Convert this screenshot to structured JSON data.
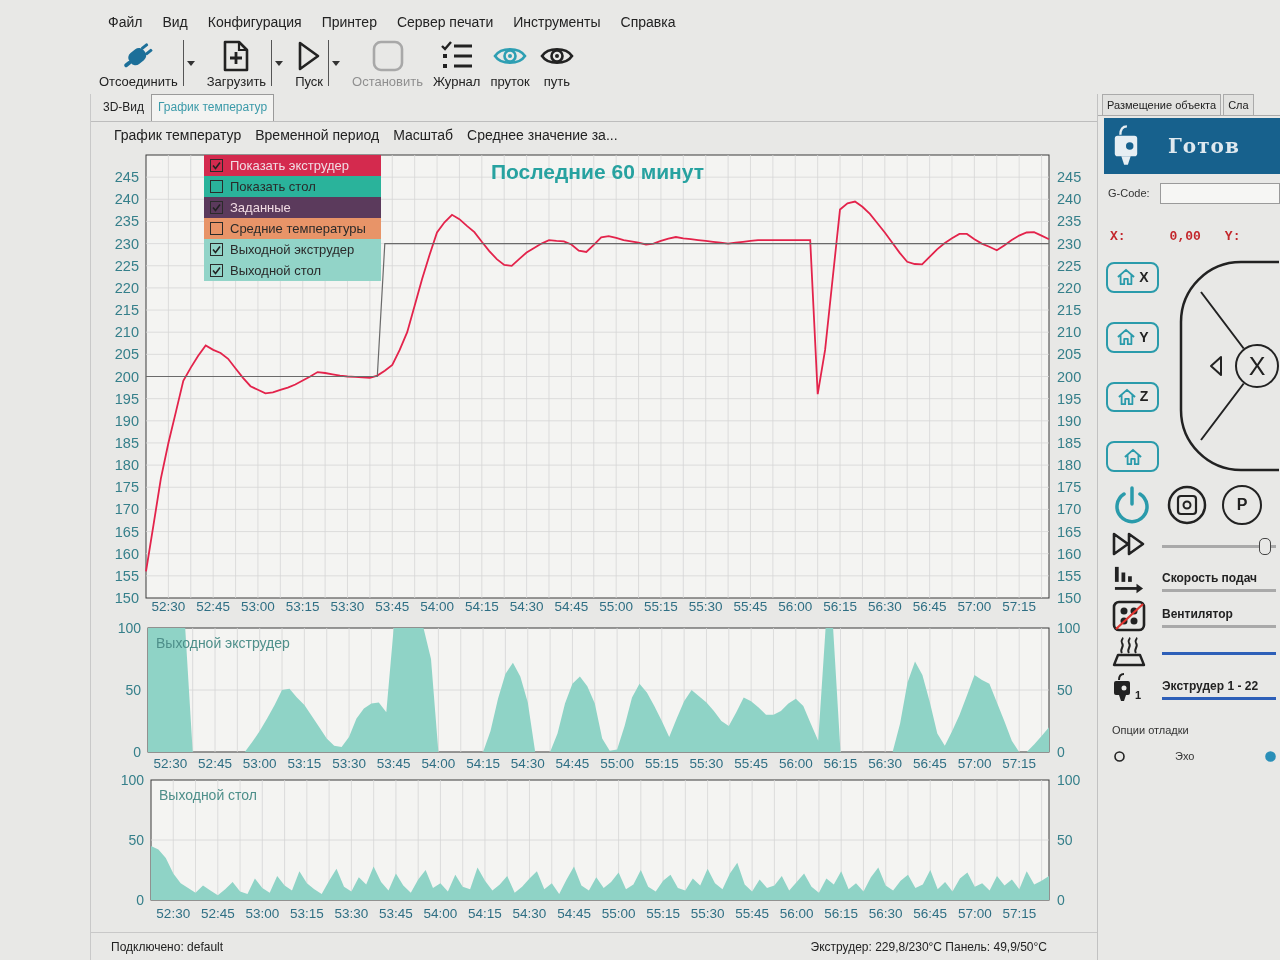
{
  "menu": [
    "Файл",
    "Вид",
    "Конфигурация",
    "Принтер",
    "Сервер печати",
    "Инструменты",
    "Справка"
  ],
  "toolbar": [
    {
      "kind": "plug",
      "label": "Отсоединить",
      "on": true,
      "disabled": false,
      "dropdown": true
    },
    {
      "kind": "file-plus",
      "label": "Загрузить",
      "on": false,
      "disabled": false,
      "dropdown": true
    },
    {
      "kind": "play",
      "label": "Пуск",
      "on": false,
      "disabled": false,
      "dropdown": true
    },
    {
      "kind": "stop",
      "label": "Остановить",
      "on": false,
      "disabled": true,
      "dropdown": false
    },
    {
      "kind": "checklist",
      "label": "Журнал",
      "on": false,
      "disabled": false,
      "dropdown": false
    },
    {
      "kind": "eye",
      "label": "пруток",
      "on": true,
      "disabled": false,
      "dropdown": false
    },
    {
      "kind": "eye",
      "label": "путь",
      "on": false,
      "disabled": false,
      "dropdown": false
    }
  ],
  "view_tabs": [
    {
      "label": "3D-Вид",
      "selected": false
    },
    {
      "label": "График температур",
      "selected": true
    }
  ],
  "chart_menu": [
    "График температур",
    "Временной период",
    "Масштаб",
    "Среднее значение за..."
  ],
  "temperature_chart": {
    "legend": [
      {
        "label": "Показать экструдер",
        "checked": true,
        "color": "#d42a4e"
      },
      {
        "label": "Показать стол",
        "checked": false,
        "color": "#2ab39b"
      },
      {
        "label": "Заданные",
        "checked": true,
        "color": "#5b3a5c"
      },
      {
        "label": "Средние температуры",
        "checked": false,
        "color": "#e89468"
      },
      {
        "label": "Выходной экструдер",
        "checked": true,
        "color": "#92d4c8"
      },
      {
        "label": "Выходной стол",
        "checked": true,
        "color": "#92d4c8"
      }
    ],
    "right_axis_ticks": [
      "245",
      "240",
      "235",
      "230",
      "225",
      "220",
      "215",
      "210",
      "205",
      "200",
      "195",
      "190",
      "185",
      "180",
      "175",
      "170",
      "165",
      "160",
      "155",
      "150"
    ],
    "chart_data": {
      "type": "line",
      "title": "Последние 60 минут",
      "grid": true,
      "categories": [
        null,
        null,
        null,
        "52:30",
        null,
        null,
        null,
        null,
        null,
        "52:45",
        null,
        null,
        null,
        null,
        null,
        "53:00",
        null,
        null,
        null,
        null,
        null,
        "53:15",
        null,
        null,
        null,
        null,
        null,
        "53:30",
        null,
        null,
        null,
        null,
        null,
        "53:45",
        null,
        null,
        null,
        null,
        null,
        "54:00",
        null,
        null,
        null,
        null,
        null,
        "54:15",
        null,
        null,
        null,
        null,
        null,
        "54:30",
        null,
        null,
        null,
        null,
        null,
        "54:45",
        null,
        null,
        null,
        null,
        null,
        "55:00",
        null,
        null,
        null,
        null,
        null,
        "55:15",
        null,
        null,
        null,
        null,
        null,
        "55:30",
        null,
        null,
        null,
        null,
        null,
        "55:45",
        null,
        null,
        null,
        null,
        null,
        "56:00",
        null,
        null,
        null,
        null,
        null,
        "56:15",
        null,
        null,
        null,
        null,
        null,
        "56:30",
        null,
        null,
        null,
        null,
        null,
        "56:45",
        null,
        null,
        null,
        null,
        null,
        "57:00",
        null,
        null,
        null,
        null,
        null,
        "57:15",
        null,
        null,
        null,
        null
      ],
      "series": [
        {
          "color": "#e3234b",
          "values": [
            156,
            166.5,
            177,
            185,
            192,
            199,
            202,
            204.7,
            207,
            206,
            205.3,
            204,
            201.8,
            199.7,
            197.8,
            197,
            196.2,
            196.4,
            197,
            197.5,
            198.2,
            199.1,
            200,
            201,
            200.8,
            200.5,
            200.2,
            200,
            199.9,
            199.8,
            199.7,
            200.2,
            201.3,
            202.6,
            206,
            210,
            216,
            222,
            227.5,
            232.5,
            234.8,
            236.5,
            235.5,
            234,
            232.6,
            230.4,
            228.3,
            226.5,
            225.2,
            225,
            226.5,
            228,
            229,
            230,
            230.8,
            230.6,
            230.5,
            229.8,
            228.4,
            228.1,
            229.7,
            231.4,
            231.7,
            231.3,
            230.8,
            230.5,
            230.2,
            229.8,
            230,
            230.6,
            231.1,
            231.5,
            231.2,
            231,
            230.8,
            230.6,
            230.4,
            230.2,
            230,
            230.2,
            230.4,
            230.6,
            230.8,
            230.8,
            230.8,
            230.8,
            230.8,
            230.8,
            230.8,
            230.8,
            196,
            206,
            222,
            237.7,
            239.1,
            239.5,
            238.3,
            236.7,
            234.6,
            232.5,
            230.2,
            227.9,
            225.9,
            225.4,
            225.3,
            227,
            228.7,
            230.1,
            231.2,
            232.2,
            232.2,
            231,
            230,
            229.3,
            228.5,
            229.6,
            230.8,
            231.8,
            232.5,
            232.6,
            231.8,
            231
          ]
        },
        {
          "color": "#6a6a6a",
          "values": [
            200,
            200,
            200,
            200,
            200,
            200,
            200,
            200,
            200,
            200,
            200,
            200,
            200,
            200,
            200,
            200,
            200,
            200,
            200,
            200,
            200,
            200,
            200,
            200,
            200,
            200,
            200,
            200,
            200,
            200,
            200,
            200,
            230,
            230,
            230,
            230,
            230,
            230,
            230,
            230,
            230,
            230,
            230,
            230,
            230,
            230,
            230,
            230,
            230,
            230,
            230,
            230,
            230,
            230,
            230,
            230,
            230,
            230,
            230,
            230,
            230,
            230,
            230,
            230,
            230,
            230,
            230,
            230,
            230,
            230,
            230,
            230,
            230,
            230,
            230,
            230,
            230,
            230,
            230,
            230,
            230,
            230,
            230,
            230,
            230,
            230,
            230,
            230,
            230,
            230,
            230,
            230,
            230,
            230,
            230,
            230,
            230,
            230,
            230,
            230,
            230,
            230,
            230,
            230,
            230,
            230,
            230,
            230,
            230,
            230,
            230,
            230,
            230,
            230,
            230,
            230,
            230,
            230,
            230,
            230,
            230,
            230
          ]
        }
      ],
      "ylim": [
        150,
        250
      ],
      "yticks": [
        150,
        155,
        160,
        165,
        170,
        175,
        180,
        185,
        190,
        195,
        200,
        205,
        210,
        215,
        220,
        225,
        230,
        235,
        240,
        245
      ]
    }
  },
  "output_extruder_chart": {
    "right_axis_ticks": [
      "100",
      "50",
      "0"
    ],
    "chart_data": {
      "type": "area",
      "title": "Выходной экструдер",
      "grid": true,
      "categories": [
        null,
        null,
        null,
        "52:30",
        null,
        null,
        null,
        null,
        null,
        "52:45",
        null,
        null,
        null,
        null,
        null,
        "53:00",
        null,
        null,
        null,
        null,
        null,
        "53:15",
        null,
        null,
        null,
        null,
        null,
        "53:30",
        null,
        null,
        null,
        null,
        null,
        "53:45",
        null,
        null,
        null,
        null,
        null,
        "54:00",
        null,
        null,
        null,
        null,
        null,
        "54:15",
        null,
        null,
        null,
        null,
        null,
        "54:30",
        null,
        null,
        null,
        null,
        null,
        "54:45",
        null,
        null,
        null,
        null,
        null,
        "55:00",
        null,
        null,
        null,
        null,
        null,
        "55:15",
        null,
        null,
        null,
        null,
        null,
        "55:30",
        null,
        null,
        null,
        null,
        null,
        "55:45",
        null,
        null,
        null,
        null,
        null,
        "56:00",
        null,
        null,
        null,
        null,
        null,
        "56:15",
        null,
        null,
        null,
        null,
        null,
        "56:30",
        null,
        null,
        null,
        null,
        null,
        "56:45",
        null,
        null,
        null,
        null,
        null,
        "57:00",
        null,
        null,
        null,
        null,
        null,
        "57:15",
        null,
        null,
        null,
        null
      ],
      "series": [
        {
          "color": "#8fd3c6",
          "values": [
            100,
            100,
            100,
            100,
            100,
            100,
            0,
            0,
            0,
            0,
            0,
            0,
            0,
            0,
            8,
            17,
            27,
            38,
            50,
            51,
            44,
            38,
            29,
            20,
            11,
            5,
            4,
            12,
            27,
            35,
            39,
            40,
            32,
            100,
            100,
            100,
            100,
            100,
            75,
            0,
            0,
            0,
            0,
            0,
            0,
            0,
            17,
            43,
            63,
            72,
            61,
            40,
            0,
            0,
            0,
            15,
            39,
            55,
            61,
            53,
            39,
            11,
            1,
            2,
            21,
            44,
            55,
            48,
            37,
            25,
            12,
            27,
            41,
            50,
            45,
            40,
            33,
            25,
            21,
            32,
            44,
            41,
            36,
            30,
            30,
            33,
            39,
            43,
            37,
            23,
            9,
            100,
            100,
            0,
            0,
            0,
            0,
            0,
            0,
            0,
            0,
            23,
            56,
            73,
            62,
            40,
            15,
            5,
            17,
            30,
            46,
            62,
            58,
            55,
            40,
            25,
            9,
            0,
            0,
            6,
            13,
            20
          ]
        }
      ],
      "ylim": [
        0,
        100
      ],
      "yticks": [
        0,
        50,
        100
      ]
    }
  },
  "output_bed_chart": {
    "right_axis_ticks": [
      "100",
      "50",
      "0"
    ],
    "chart_data": {
      "type": "area",
      "title": "Выходной стол",
      "grid": true,
      "categories": [
        null,
        null,
        null,
        "52:30",
        null,
        null,
        null,
        null,
        null,
        "52:45",
        null,
        null,
        null,
        null,
        null,
        "53:00",
        null,
        null,
        null,
        null,
        null,
        "53:15",
        null,
        null,
        null,
        null,
        null,
        "53:30",
        null,
        null,
        null,
        null,
        null,
        "53:45",
        null,
        null,
        null,
        null,
        null,
        "54:00",
        null,
        null,
        null,
        null,
        null,
        "54:15",
        null,
        null,
        null,
        null,
        null,
        "54:30",
        null,
        null,
        null,
        null,
        null,
        "54:45",
        null,
        null,
        null,
        null,
        null,
        "55:00",
        null,
        null,
        null,
        null,
        null,
        "55:15",
        null,
        null,
        null,
        null,
        null,
        "55:30",
        null,
        null,
        null,
        null,
        null,
        "55:45",
        null,
        null,
        null,
        null,
        null,
        "56:00",
        null,
        null,
        null,
        null,
        null,
        "56:15",
        null,
        null,
        null,
        null,
        null,
        "56:30",
        null,
        null,
        null,
        null,
        null,
        "56:45",
        null,
        null,
        null,
        null,
        null,
        "57:00",
        null,
        null,
        null,
        null,
        null,
        "57:15",
        null,
        null,
        null,
        null
      ],
      "series": [
        {
          "color": "#8fd3c6",
          "values": [
            45,
            42,
            35,
            22,
            14,
            10,
            6,
            12,
            8,
            4,
            9,
            15,
            7,
            5,
            18,
            10,
            6,
            20,
            12,
            8,
            24,
            14,
            9,
            5,
            16,
            26,
            11,
            7,
            19,
            13,
            28,
            15,
            8,
            22,
            12,
            6,
            17,
            25,
            10,
            14,
            7,
            21,
            11,
            9,
            27,
            16,
            8,
            13,
            20,
            6,
            11,
            18,
            24,
            9,
            14,
            5,
            17,
            28,
            12,
            8,
            19,
            10,
            15,
            23,
            9,
            13,
            25,
            11,
            7,
            16,
            21,
            10,
            8,
            18,
            12,
            26,
            14,
            9,
            22,
            31,
            13,
            7,
            17,
            10,
            12,
            20,
            8,
            15,
            22,
            11,
            6,
            18,
            13,
            24,
            9,
            14,
            7,
            19,
            27,
            12,
            8,
            16,
            21,
            10,
            13,
            25,
            9,
            15,
            7,
            18,
            23,
            11,
            14,
            8,
            20,
            12,
            17,
            9,
            24,
            13,
            16,
            20
          ]
        }
      ],
      "ylim": [
        0,
        100
      ],
      "yticks": [
        0,
        50,
        100
      ]
    }
  },
  "status_bar": {
    "connection": "Подключено: default",
    "temperatures": "Экструдер: 229,8/230°C Панель: 49,9/50°C"
  },
  "side_panel": {
    "tabs": [
      {
        "label": "Размещение объекта",
        "selected": false
      },
      {
        "label": "Сла",
        "selected": false
      }
    ],
    "status": "Готов",
    "gcode": {
      "label": "G-Code:"
    },
    "position": {
      "x_label": "X:",
      "x_value": "0,00",
      "y_label": "Y:"
    },
    "home_buttons": [
      {
        "kind": "axis",
        "label": "X"
      },
      {
        "kind": "axis",
        "label": "Y"
      },
      {
        "kind": "axis",
        "label": "Z"
      },
      {
        "kind": "all"
      }
    ],
    "jog": {
      "center_label": "X"
    },
    "round_buttons": [
      {
        "kind": "power"
      },
      {
        "kind": "square-dot"
      },
      {
        "kind": "letter",
        "label": "P"
      }
    ],
    "controls": [
      {
        "kind": "speed",
        "on": false,
        "level": 0.95
      },
      {
        "kind": "feed",
        "label": "Скорость подач",
        "on": false
      },
      {
        "kind": "fan",
        "label": "Вентилятор",
        "on": false
      },
      {
        "kind": "bed",
        "on": true
      },
      {
        "kind": "extruder",
        "badge": "1",
        "label": "Экструдер 1 - 22",
        "on": true
      }
    ],
    "debug": {
      "title": "Опции отладки",
      "options": [
        {
          "label": "Эхо",
          "checked": false
        },
        {
          "checked": true
        }
      ]
    }
  }
}
